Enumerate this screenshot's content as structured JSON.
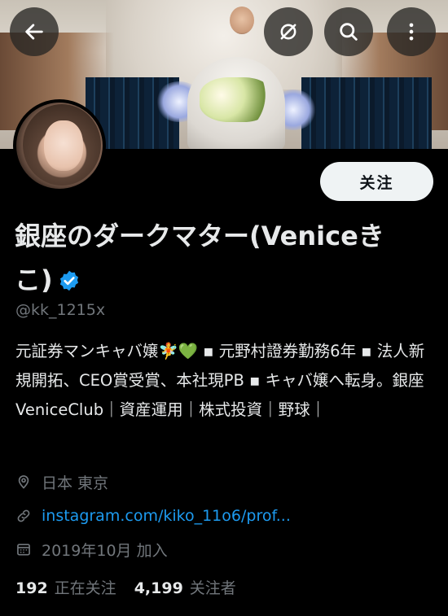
{
  "profile": {
    "follow_label": "关注",
    "display_name": "銀座のダークマター(Veniceきこ)",
    "handle": "@kk_1215x",
    "bio": "元証券マンキャバ嬢🧚💚 ▪︎ 元野村證券勤務6年 ▪︎ 法人新規開拓、CEO賞受賞、本社現PB ▪︎ キャバ嬢へ転身。銀座VeniceClub｜資産運用｜株式投資｜野球｜",
    "location": "日本 東京",
    "website": "instagram.com/kiko_11o6/prof...",
    "joined": "2019年10月 加入",
    "following_count": "192",
    "following_label": "正在关注",
    "followers_count": "4,199",
    "followers_label": "关注者"
  },
  "header_buttons": [
    {
      "icon": "back-arrow-icon"
    },
    {
      "icon": "grok-icon"
    },
    {
      "icon": "search-icon"
    },
    {
      "icon": "more-vertical-icon"
    }
  ],
  "colors": {
    "background": "#000000",
    "text_primary": "#e7e9ea",
    "text_secondary": "#71767b",
    "link": "#1d9bf0",
    "verified": "#1d9bf0",
    "follow_button_bg": "#eff3f4"
  }
}
